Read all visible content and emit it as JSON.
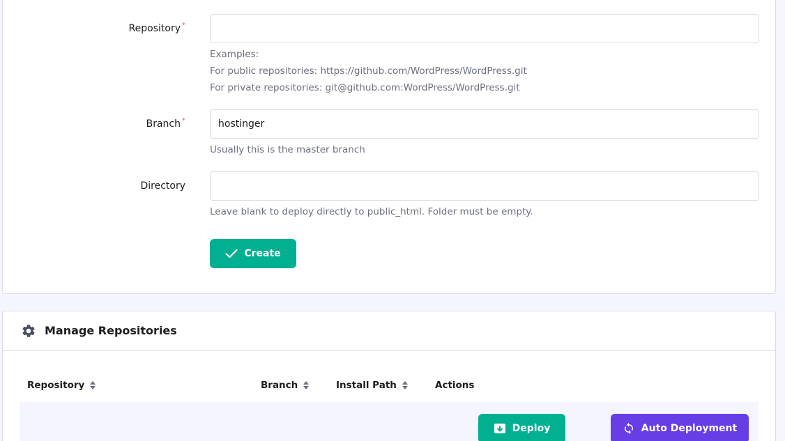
{
  "form": {
    "repository": {
      "label": "Repository",
      "required_mark": "*",
      "value": "",
      "hints": [
        "Examples:",
        "For public repositories: https://github.com/WordPress/WordPress.git",
        "For private repositories: git@github.com:WordPress/WordPress.git"
      ]
    },
    "branch": {
      "label": "Branch",
      "required_mark": "*",
      "value": "hostinger",
      "hint": "Usually this is the master branch"
    },
    "directory": {
      "label": "Directory",
      "value": "",
      "hint": "Leave blank to deploy directly to public_html. Folder must be empty."
    },
    "create_label": "Create"
  },
  "manage": {
    "title": "Manage Repositories",
    "columns": [
      "Repository",
      "Branch",
      "Install Path",
      "Actions"
    ],
    "deploy_label": "Deploy",
    "auto_deploy_label": "Auto Deployment"
  },
  "colors": {
    "primary_green": "#00b090",
    "primary_purple": "#673de6",
    "required": "#fc5185"
  }
}
